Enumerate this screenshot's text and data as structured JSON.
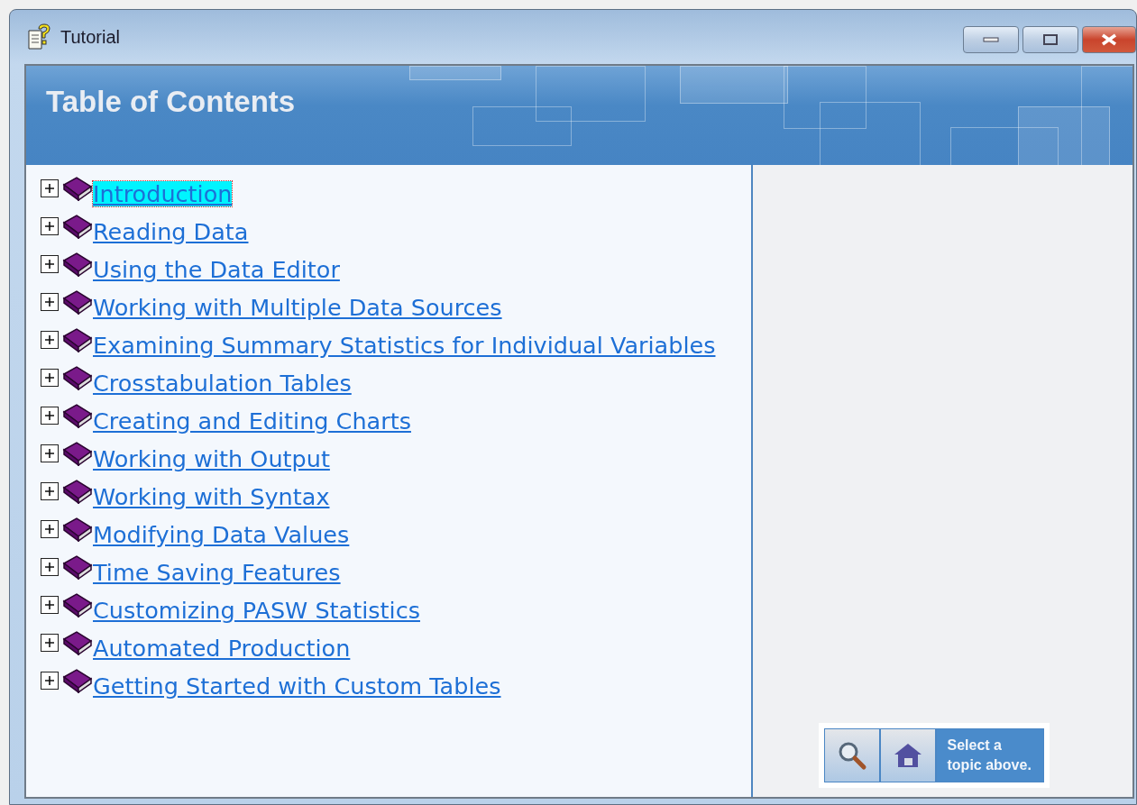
{
  "window": {
    "title": "Tutorial"
  },
  "header": {
    "title": "Table of Contents"
  },
  "toc": [
    {
      "label": "Introduction",
      "selected": true,
      "expanded": false
    },
    {
      "label": "Reading Data",
      "selected": false,
      "expanded": false
    },
    {
      "label": "Using the Data Editor",
      "selected": false,
      "expanded": false
    },
    {
      "label": "Working with Multiple Data Sources",
      "selected": false,
      "expanded": false
    },
    {
      "label": "Examining Summary Statistics for Individual Variables",
      "selected": false,
      "expanded": false
    },
    {
      "label": "Crosstabulation Tables",
      "selected": false,
      "expanded": false
    },
    {
      "label": "Creating and Editing Charts",
      "selected": false,
      "expanded": false
    },
    {
      "label": "Working with Output",
      "selected": false,
      "expanded": false
    },
    {
      "label": "Working with Syntax",
      "selected": false,
      "expanded": false
    },
    {
      "label": "Modifying Data Values",
      "selected": false,
      "expanded": false
    },
    {
      "label": "Time Saving Features",
      "selected": false,
      "expanded": false
    },
    {
      "label": "Customizing PASW Statistics",
      "selected": false,
      "expanded": false
    },
    {
      "label": "Automated Production",
      "selected": false,
      "expanded": false
    },
    {
      "label": "Getting Started with Custom Tables",
      "selected": false,
      "expanded": false
    }
  ],
  "nav": {
    "hint": "Select a topic above."
  }
}
